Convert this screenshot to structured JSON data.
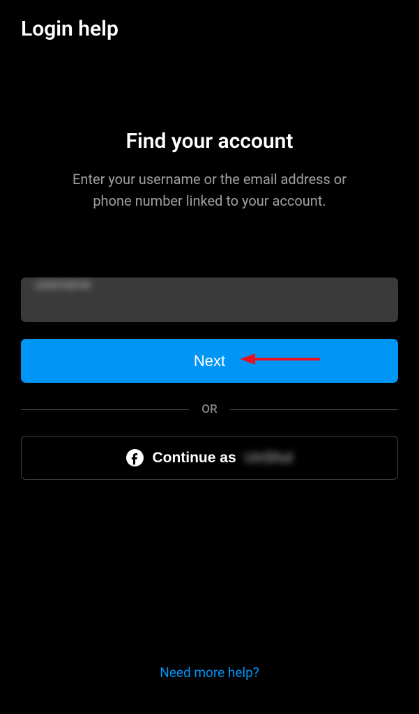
{
  "header": {
    "title": "Login help"
  },
  "main": {
    "heading": "Find your account",
    "subheading": "Enter your username or the email address or phone number linked to your account.",
    "input_value": "username",
    "next_label": "Next",
    "divider_label": "OR",
    "fb_continue_prefix": "Continue as",
    "fb_name": "UnShul"
  },
  "footer": {
    "help_link": "Need more help?"
  },
  "colors": {
    "accent": "#0096f6",
    "background": "#000000",
    "input_bg": "#3a3a3a",
    "muted": "#a0a0a0"
  }
}
